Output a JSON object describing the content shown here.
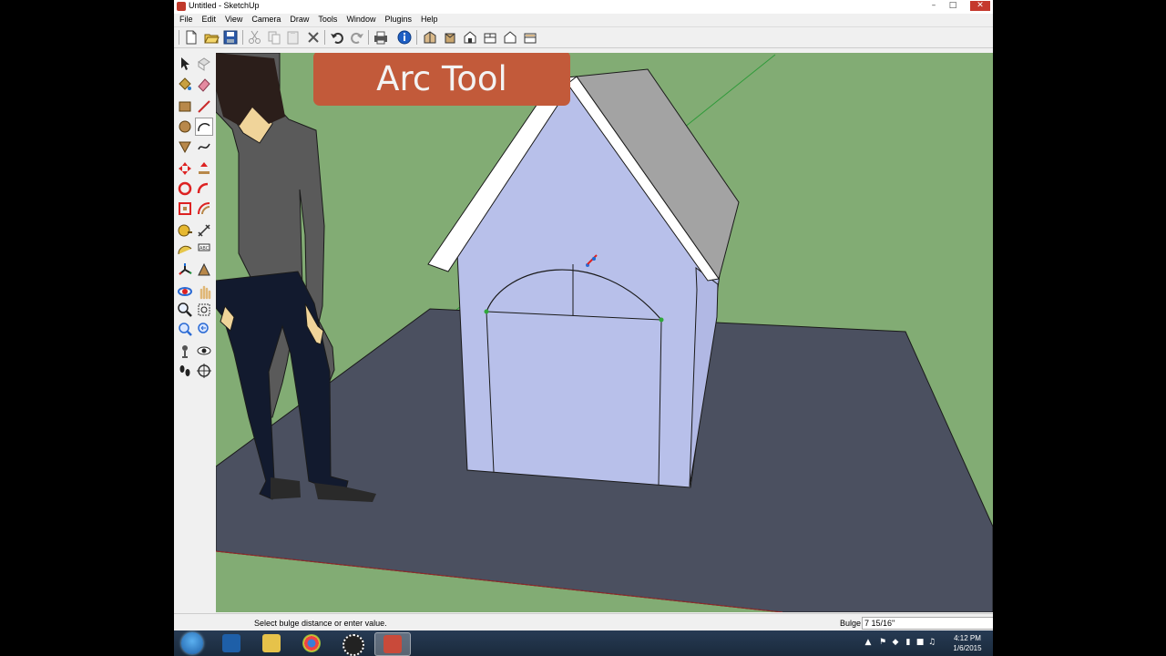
{
  "window": {
    "title": "Untitled - SketchUp",
    "controls": [
      "minimize",
      "maximize",
      "close"
    ]
  },
  "menu": [
    "File",
    "Edit",
    "View",
    "Camera",
    "Draw",
    "Tools",
    "Window",
    "Plugins",
    "Help"
  ],
  "toolbar": {
    "tools": [
      "new-icon",
      "open-icon",
      "save-icon",
      "cut-icon",
      "copy-icon",
      "paste-icon",
      "erase-icon",
      "undo-icon",
      "redo-icon",
      "print-icon",
      "model-info-icon",
      "iso-view-icon",
      "top-view-icon",
      "front-view-icon",
      "right-view-icon",
      "back-view-icon",
      "left-view-icon"
    ]
  },
  "left_toolbar": {
    "active_tool": "arc-tool",
    "tools": [
      "select-icon",
      "make-component-icon",
      "paint-bucket-icon",
      "eraser-icon",
      "rectangle-icon",
      "line-icon",
      "circle-icon",
      "arc-icon",
      "polygon-icon",
      "freehand-icon",
      "move-icon",
      "push-pull-icon",
      "rotate-icon",
      "follow-me-icon",
      "scale-icon",
      "offset-icon",
      "tape-measure-icon",
      "dimension-icon",
      "protractor-icon",
      "text-icon",
      "axes-icon",
      "3d-text-icon",
      "orbit-icon",
      "pan-icon",
      "zoom-icon",
      "zoom-window-icon",
      "zoom-extents-icon",
      "previous-icon",
      "position-camera-icon",
      "look-around-icon",
      "walk-icon",
      "section-plane-icon"
    ]
  },
  "banner": {
    "text": "Arc Tool"
  },
  "status": {
    "hint": "Select bulge distance or enter value.",
    "vcb_label": "Bulge",
    "vcb_value": "7 15/16\""
  },
  "taskbar": {
    "apps": [
      "start-button",
      "metro-app",
      "file-explorer",
      "chrome",
      "media-app",
      "sketchup"
    ],
    "active_app": "sketchup",
    "clock_time": "4:12 PM",
    "clock_date": "1/6/2015"
  },
  "colors": {
    "ground": "#82ac74",
    "floor": "#4b5060",
    "house_face": "#b8c0ea",
    "roof_gray": "#a3a3a3",
    "banner": "#c25a3a"
  }
}
